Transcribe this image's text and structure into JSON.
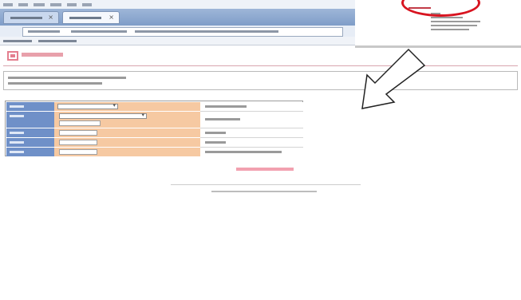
{
  "browser": {
    "nav_back": "",
    "nav_forward": "",
    "tabs": [
      {
        "label": "",
        "close": "×"
      },
      {
        "label": "",
        "close": "×"
      }
    ]
  },
  "page": {
    "form_rows": [
      {
        "label": "",
        "hint": ""
      },
      {
        "label": "",
        "hint": ""
      },
      {
        "label": "",
        "hint": ""
      },
      {
        "label": "",
        "hint": ""
      },
      {
        "label": "",
        "hint": ""
      }
    ]
  },
  "colors": {
    "label_cell": "#6f90c8",
    "input_cell": "#f6c9a2",
    "accent_pink": "#e47f8f",
    "annotation_red": "#d81420"
  },
  "icons": [
    "logo-icon",
    "chevron-down-icon",
    "close-icon",
    "down-left-arrow-annotation"
  ]
}
